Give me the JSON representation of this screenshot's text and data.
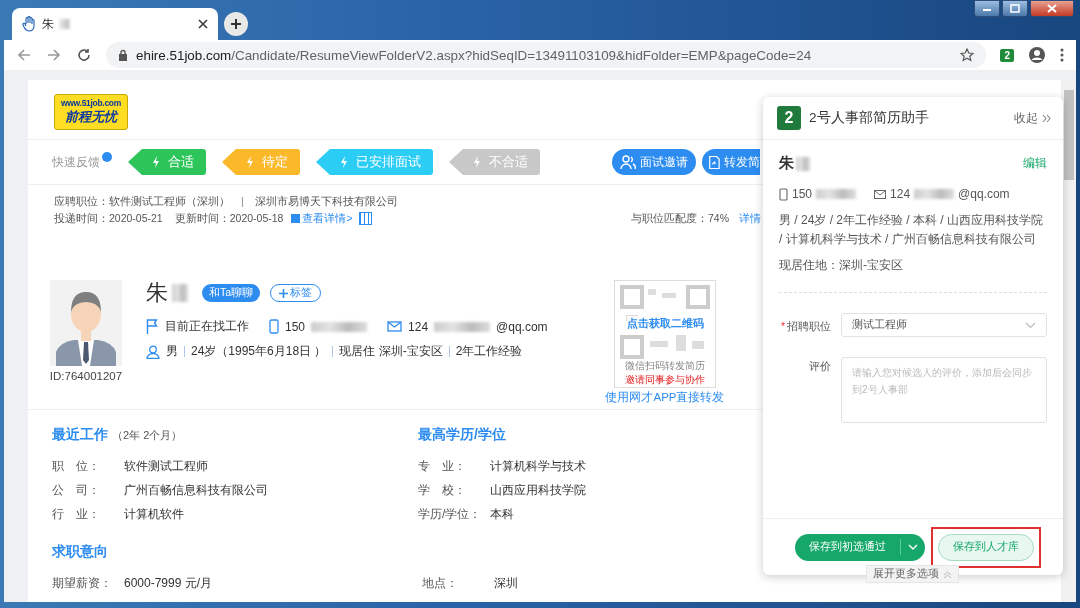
{
  "browser": {
    "tab_title": "朱",
    "url_host": "ehire.51job.com",
    "url_path": "/Candidate/ResumeViewFolderV2.aspx?hidSeqID=13491103109&hidFolder=EMP&pageCode=24",
    "extension_badge": "2"
  },
  "logo": {
    "url": "www.51job.com",
    "name": "前程无忧"
  },
  "feedback": {
    "label": "快速反馈",
    "tags": [
      {
        "label": "合适",
        "color": "#2dc55a"
      },
      {
        "label": "待定",
        "color": "#fbb92a"
      },
      {
        "label": "已安排面试",
        "color": "#2ccdf5"
      },
      {
        "label": "不合适",
        "color": "#c8c8c8"
      }
    ]
  },
  "actions": [
    {
      "label": "面试邀请",
      "kind": "interview"
    },
    {
      "label": "转发简",
      "kind": "forward"
    }
  ],
  "application": {
    "position": "应聘职位：软件测试工程师（深圳）",
    "company": "深圳市易博天下科技有限公司",
    "delivered": "投递时间：2020-05-21",
    "updated": "更新时间：2020-05-18",
    "details_link": "查看详情>",
    "match": "与职位匹配度：74%",
    "match_link": "详情"
  },
  "profile": {
    "id": "ID:764001207",
    "name": "朱",
    "chat": "和Ta聊聊",
    "tag": "标签",
    "status": "目前正在找工作",
    "phone": "150",
    "email_prefix": "124",
    "email_suffix": "@qq.com",
    "details": [
      "男",
      "24岁（1995年6月18日 ）",
      "现居住 深圳-宝安区",
      "2年工作经验"
    ]
  },
  "qr": {
    "overlay": "点击获取二维码",
    "line1": "微信扫码转发简历",
    "line2": "邀请同事参与协作",
    "link": "使用网才APP直接转发"
  },
  "recent_work": {
    "title": "最近工作",
    "duration": "（2年 2个月）",
    "fields": [
      {
        "label": "职　位：",
        "value": "软件测试工程师"
      },
      {
        "label": "公　司：",
        "value": "广州百畅信息科技有限公司"
      },
      {
        "label": "行　业：",
        "value": "计算机软件"
      }
    ]
  },
  "education": {
    "title": "最高学历/学位",
    "fields": [
      {
        "label": "专　业：",
        "value": "计算机科学与技术"
      },
      {
        "label": "学　校：",
        "value": "山西应用科技学院"
      },
      {
        "label": "学历/学位：",
        "value": "本科"
      }
    ]
  },
  "intent": {
    "title": "求职意向",
    "fields": [
      {
        "label": "期望薪资：",
        "value": "6000-7999 元/月"
      },
      {
        "label": "地点：",
        "value": "深圳"
      }
    ]
  },
  "panel": {
    "logo_text": "2",
    "title": "2号人事部简历助手",
    "collapse": "收起",
    "name": "朱",
    "edit": "编辑",
    "phone": "150",
    "email_prefix": "124",
    "email_suffix": "@qq.com",
    "summary": "男 / 24岁 / 2年工作经验 / 本科 / 山西应用科技学院 / 计算机科学与技术 / 广州百畅信息科技有限公司",
    "residence": "现居住地：深圳-宝安区",
    "required_mark": "*",
    "position_label": "招聘职位",
    "position_value": "测试工程师",
    "comment_label": "评价",
    "comment_placeholder": "请输入您对候选人的评价，添加后会同步到2号人事部",
    "primary": "保存到初选通过",
    "secondary": "保存到人才库",
    "secondary_highlighted": true,
    "more": "展开更多选项"
  }
}
